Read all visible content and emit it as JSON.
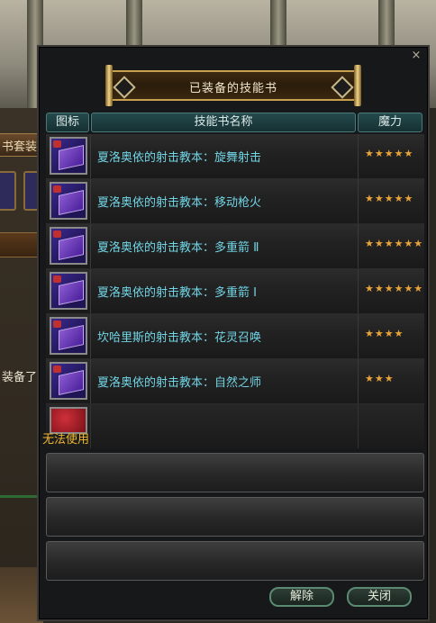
{
  "background": {
    "tab_label": "书套装",
    "equipped_label": "装备了"
  },
  "window": {
    "title": "已装备的技能书",
    "close_label": "×"
  },
  "table": {
    "headers": [
      "图标",
      "技能书名称",
      "魔力"
    ],
    "rows": [
      {
        "name": "夏洛奥依的射击教本：旋舞射击",
        "stars": "★★★★★"
      },
      {
        "name": "夏洛奥依的射击教本：移动枪火",
        "stars": "★★★★★"
      },
      {
        "name": "夏洛奥依的射击教本：多重箭 Ⅱ",
        "stars": "★★★★★★"
      },
      {
        "name": "夏洛奥依的射击教本：多重箭 Ⅰ",
        "stars": "★★★★★★"
      },
      {
        "name": "坎哈里斯的射击教本：花灵召唤",
        "stars": "★★★★"
      },
      {
        "name": "夏洛奥依的射击教本：自然之师",
        "stars": "★★★"
      }
    ],
    "unusable_label": "无法使用"
  },
  "buttons": {
    "release": "解除",
    "close": "关闭"
  },
  "colors": {
    "book_name": "#72d4e4",
    "stars": "#e8a43a",
    "unusable": "#f0b830"
  }
}
